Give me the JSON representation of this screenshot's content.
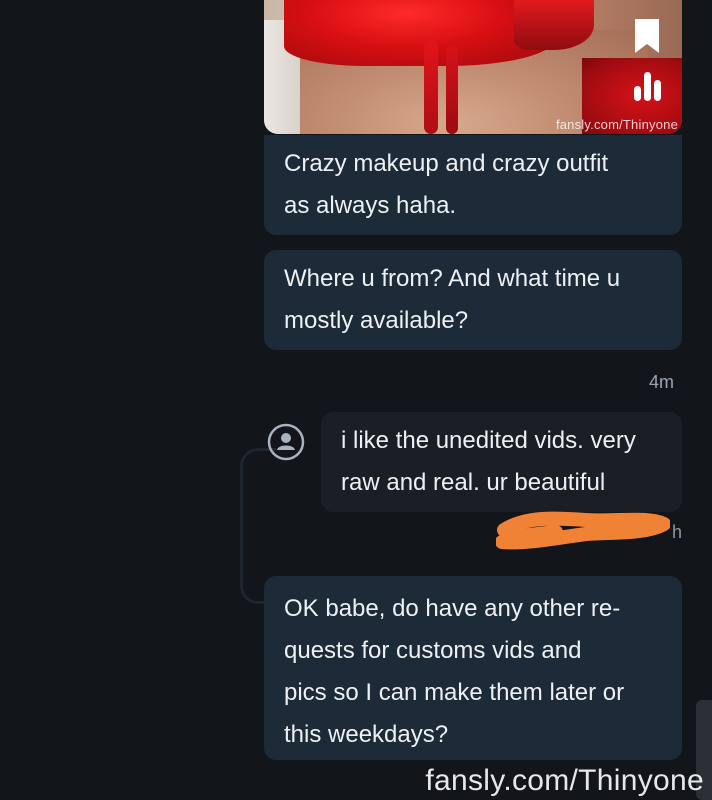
{
  "photo": {
    "watermark": "fansly.com/Thinyone"
  },
  "messages": [
    {
      "text": "Crazy makeup and crazy outfit\nas always haha."
    },
    {
      "text": "Where u from? And what time u\nmostly available?"
    },
    {
      "text": "i like the unedited vids. very\nraw and real. ur beautiful"
    },
    {
      "text": "OK babe, do have any other re-\nquests for customs vids and\npics so I can make them later or\nthis weekdays?"
    }
  ],
  "timestamps": {
    "first": "4m",
    "second": "h"
  },
  "footer": {
    "watermark": "fansly.com/Thinyone"
  },
  "colors": {
    "bubble_outgoing": "#1d2a38",
    "bubble_incoming": "#1a1f26",
    "background": "#121519",
    "redaction": "#f08235"
  }
}
